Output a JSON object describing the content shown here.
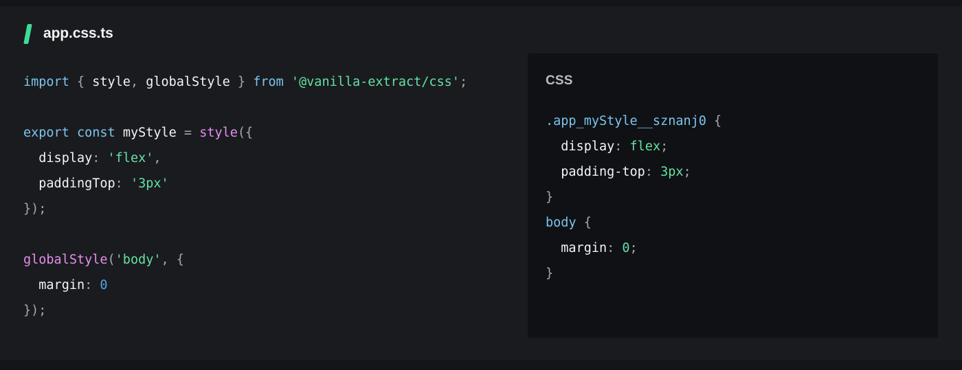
{
  "window": {
    "background": "#1a1b1e",
    "accent_green": "#3ddc97"
  },
  "file_header": {
    "icon": "backslash-icon",
    "filename": "app.css.ts"
  },
  "source_code": {
    "language": "typescript",
    "lines": [
      [
        {
          "t": "import",
          "c": "t-kw"
        },
        {
          "t": " ",
          "c": "t-punc"
        },
        {
          "t": "{",
          "c": "t-punc"
        },
        {
          "t": " ",
          "c": "t-punc"
        },
        {
          "t": "style",
          "c": "t-id"
        },
        {
          "t": ",",
          "c": "t-punc"
        },
        {
          "t": " ",
          "c": "t-punc"
        },
        {
          "t": "globalStyle",
          "c": "t-id"
        },
        {
          "t": " ",
          "c": "t-punc"
        },
        {
          "t": "}",
          "c": "t-punc"
        },
        {
          "t": " ",
          "c": "t-punc"
        },
        {
          "t": "from",
          "c": "t-kw"
        },
        {
          "t": " ",
          "c": "t-punc"
        },
        {
          "t": "'@vanilla-extract/css'",
          "c": "t-str"
        },
        {
          "t": ";",
          "c": "t-punc"
        }
      ],
      [],
      [
        {
          "t": "export",
          "c": "t-kw"
        },
        {
          "t": " ",
          "c": "t-punc"
        },
        {
          "t": "const",
          "c": "t-kw"
        },
        {
          "t": " ",
          "c": "t-punc"
        },
        {
          "t": "myStyle",
          "c": "t-id"
        },
        {
          "t": " ",
          "c": "t-punc"
        },
        {
          "t": "=",
          "c": "t-op"
        },
        {
          "t": " ",
          "c": "t-punc"
        },
        {
          "t": "style",
          "c": "t-fn"
        },
        {
          "t": "({",
          "c": "t-punc"
        }
      ],
      [
        {
          "t": "  ",
          "c": "t-punc"
        },
        {
          "t": "display",
          "c": "t-id"
        },
        {
          "t": ":",
          "c": "t-punc"
        },
        {
          "t": " ",
          "c": "t-punc"
        },
        {
          "t": "'flex'",
          "c": "t-str"
        },
        {
          "t": ",",
          "c": "t-punc"
        }
      ],
      [
        {
          "t": "  ",
          "c": "t-punc"
        },
        {
          "t": "paddingTop",
          "c": "t-id"
        },
        {
          "t": ":",
          "c": "t-punc"
        },
        {
          "t": " ",
          "c": "t-punc"
        },
        {
          "t": "'3px'",
          "c": "t-str"
        }
      ],
      [
        {
          "t": "});",
          "c": "t-punc"
        }
      ],
      [],
      [
        {
          "t": "globalStyle",
          "c": "t-fn"
        },
        {
          "t": "(",
          "c": "t-punc"
        },
        {
          "t": "'body'",
          "c": "t-str"
        },
        {
          "t": ",",
          "c": "t-punc"
        },
        {
          "t": " ",
          "c": "t-punc"
        },
        {
          "t": "{",
          "c": "t-punc"
        }
      ],
      [
        {
          "t": "  ",
          "c": "t-punc"
        },
        {
          "t": "margin",
          "c": "t-id"
        },
        {
          "t": ":",
          "c": "t-punc"
        },
        {
          "t": " ",
          "c": "t-punc"
        },
        {
          "t": "0",
          "c": "t-num"
        }
      ],
      [
        {
          "t": "});",
          "c": "t-punc"
        }
      ]
    ]
  },
  "css_panel": {
    "title": "CSS",
    "lines": [
      [
        {
          "t": ".app_myStyle__sznanj0",
          "c": "c-sel"
        },
        {
          "t": " {",
          "c": "c-punc"
        }
      ],
      [
        {
          "t": "  ",
          "c": "c-punc"
        },
        {
          "t": "display",
          "c": "c-prop"
        },
        {
          "t": ":",
          "c": "c-punc"
        },
        {
          "t": " ",
          "c": "c-punc"
        },
        {
          "t": "flex",
          "c": "c-val"
        },
        {
          "t": ";",
          "c": "c-punc"
        }
      ],
      [
        {
          "t": "  ",
          "c": "c-punc"
        },
        {
          "t": "padding-top",
          "c": "c-prop"
        },
        {
          "t": ":",
          "c": "c-punc"
        },
        {
          "t": " ",
          "c": "c-punc"
        },
        {
          "t": "3px",
          "c": "c-val"
        },
        {
          "t": ";",
          "c": "c-punc"
        }
      ],
      [
        {
          "t": "}",
          "c": "c-punc"
        }
      ],
      [
        {
          "t": "body",
          "c": "c-sel"
        },
        {
          "t": " {",
          "c": "c-punc"
        }
      ],
      [
        {
          "t": "  ",
          "c": "c-punc"
        },
        {
          "t": "margin",
          "c": "c-prop"
        },
        {
          "t": ":",
          "c": "c-punc"
        },
        {
          "t": " ",
          "c": "c-punc"
        },
        {
          "t": "0",
          "c": "c-val"
        },
        {
          "t": ";",
          "c": "c-punc"
        }
      ],
      [
        {
          "t": "}",
          "c": "c-punc"
        }
      ]
    ]
  }
}
